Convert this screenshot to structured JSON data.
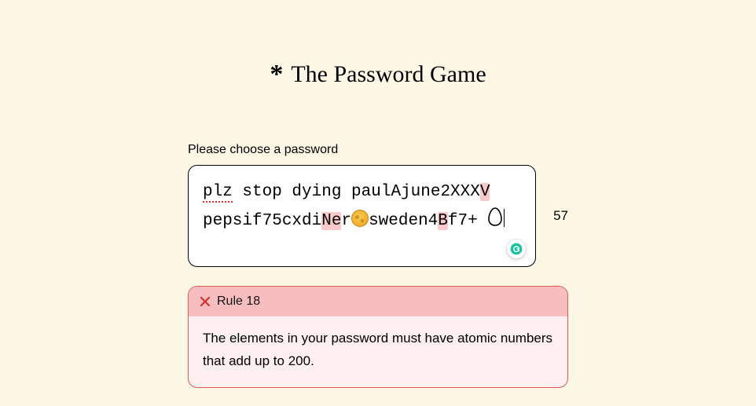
{
  "header": {
    "asterisk": "*",
    "title": "The Password Game"
  },
  "prompt": "Please choose a password",
  "password": {
    "char_count": "57",
    "segments": [
      {
        "text": "plz",
        "highlight": false,
        "squiggle": true
      },
      {
        "text": " stop dying paulAjune2XXX",
        "highlight": false
      },
      {
        "text": "V",
        "highlight": true
      },
      {
        "text": " pepsif75cxdi",
        "highlight": false
      },
      {
        "text": "Ne",
        "highlight": true
      },
      {
        "text": "r",
        "highlight": false
      },
      {
        "icon": "moon"
      },
      {
        "text": "sweden4",
        "highlight": false
      },
      {
        "text": "B",
        "highlight": true
      },
      {
        "text": "f7+ ",
        "highlight": false
      },
      {
        "icon": "egg"
      },
      {
        "caret": true
      }
    ],
    "grammarly_name": "grammarly-icon"
  },
  "rule": {
    "number_label": "Rule 18",
    "status": "fail",
    "text": "The elements in your password must have atomic numbers that add up to 200."
  }
}
